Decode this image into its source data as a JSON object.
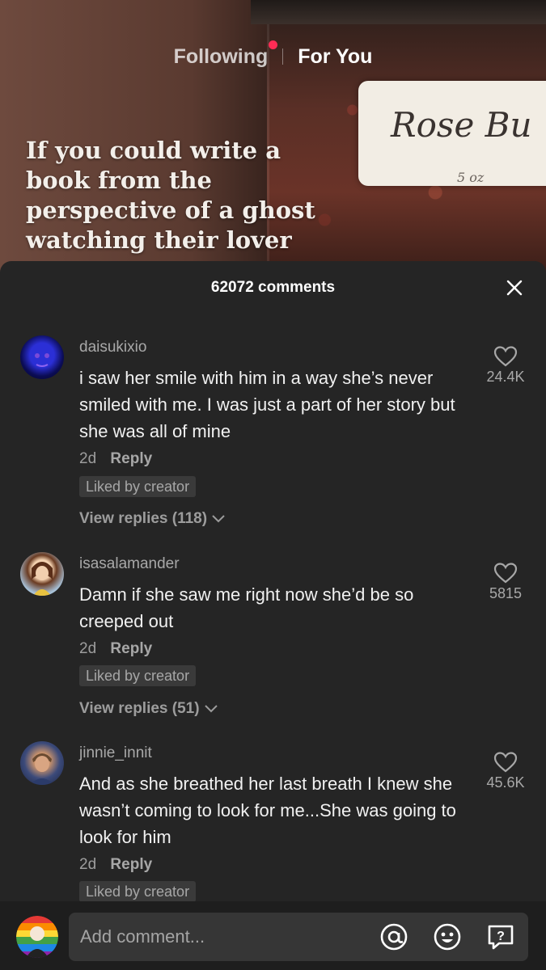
{
  "nav": {
    "tab_following": "Following",
    "tab_for_you": "For You",
    "notification_dot_color": "#fe2c55"
  },
  "video": {
    "caption": "If you could write a book from the perspective of a ghost watching their lover",
    "jar_label": "Rose Bu",
    "jar_weight": "5 oz"
  },
  "comments_sheet": {
    "title": "62072 comments",
    "close_icon": "close-icon",
    "comments": [
      {
        "username": "daisukixio",
        "text": "i saw her smile with him in a way she’s never smiled with me. I was just a part of her story but she was all of mine",
        "age": "2d",
        "reply_label": "Reply",
        "badge": "Liked by creator",
        "view_replies": "View replies (118)",
        "likes": "24.4K"
      },
      {
        "username": "isasalamander",
        "text": "Damn if she saw me right now she’d be so creeped out",
        "age": "2d",
        "reply_label": "Reply",
        "badge": "Liked by creator",
        "view_replies": "View replies (51)",
        "likes": "5815"
      },
      {
        "username": "jinnie_innit",
        "text": "And as she breathed her last breath I knew she wasn’t coming to look for me...She was going to look for him",
        "age": "2d",
        "reply_label": "Reply",
        "badge": "Liked by creator",
        "likes": "45.6K"
      }
    ]
  },
  "composer": {
    "placeholder": "Add comment...",
    "icons": [
      "at-mention-icon",
      "emoji-icon",
      "question-icon"
    ]
  }
}
